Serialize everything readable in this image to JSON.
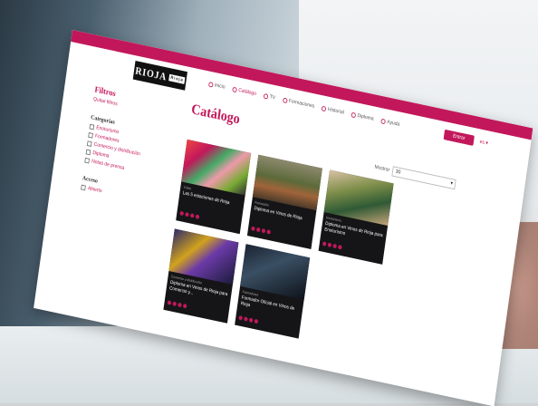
{
  "header": {
    "logo_text": "RIOJA",
    "logo_sub": "Rioja",
    "enter_label": "Entrar",
    "lang_label": "es ▾"
  },
  "nav": {
    "items": [
      {
        "label": "Inicio"
      },
      {
        "label": "Catálogo"
      },
      {
        "label": "TV"
      },
      {
        "label": "Formaciones"
      },
      {
        "label": "Historial"
      },
      {
        "label": "Diploma"
      },
      {
        "label": "Ayuda"
      }
    ]
  },
  "sidebar": {
    "filters_title": "Filtros",
    "clear_label": "Quitar filtros",
    "categories_title": "Categorías",
    "categories": [
      {
        "label": "Enoturismo"
      },
      {
        "label": "Formadores"
      },
      {
        "label": "Comercio y distribución"
      },
      {
        "label": "Diploma"
      },
      {
        "label": "Notas de prensa"
      }
    ],
    "access_title": "Acceso",
    "access": [
      {
        "label": "Abierto"
      }
    ]
  },
  "main": {
    "title": "Catálogo",
    "show_label": "Mostrar",
    "show_value": "30"
  },
  "cards": [
    {
      "category": "Vídeo",
      "title": "Las 5 estaciones de Rioja"
    },
    {
      "category": "Formación",
      "title": "Diploma en Vinos de Rioja"
    },
    {
      "category": "Enoturismo",
      "title": "Diploma en Vinos de Rioja para Enoturismo"
    },
    {
      "category": "Comercio y distribución",
      "title": "Diploma en Vinos de Rioja para Comercio y..."
    },
    {
      "category": "Formadores",
      "title": "Formador Oficial en Vinos de Rioja"
    }
  ],
  "colors": {
    "accent": "#c2185b",
    "card_bg": "#151517"
  }
}
